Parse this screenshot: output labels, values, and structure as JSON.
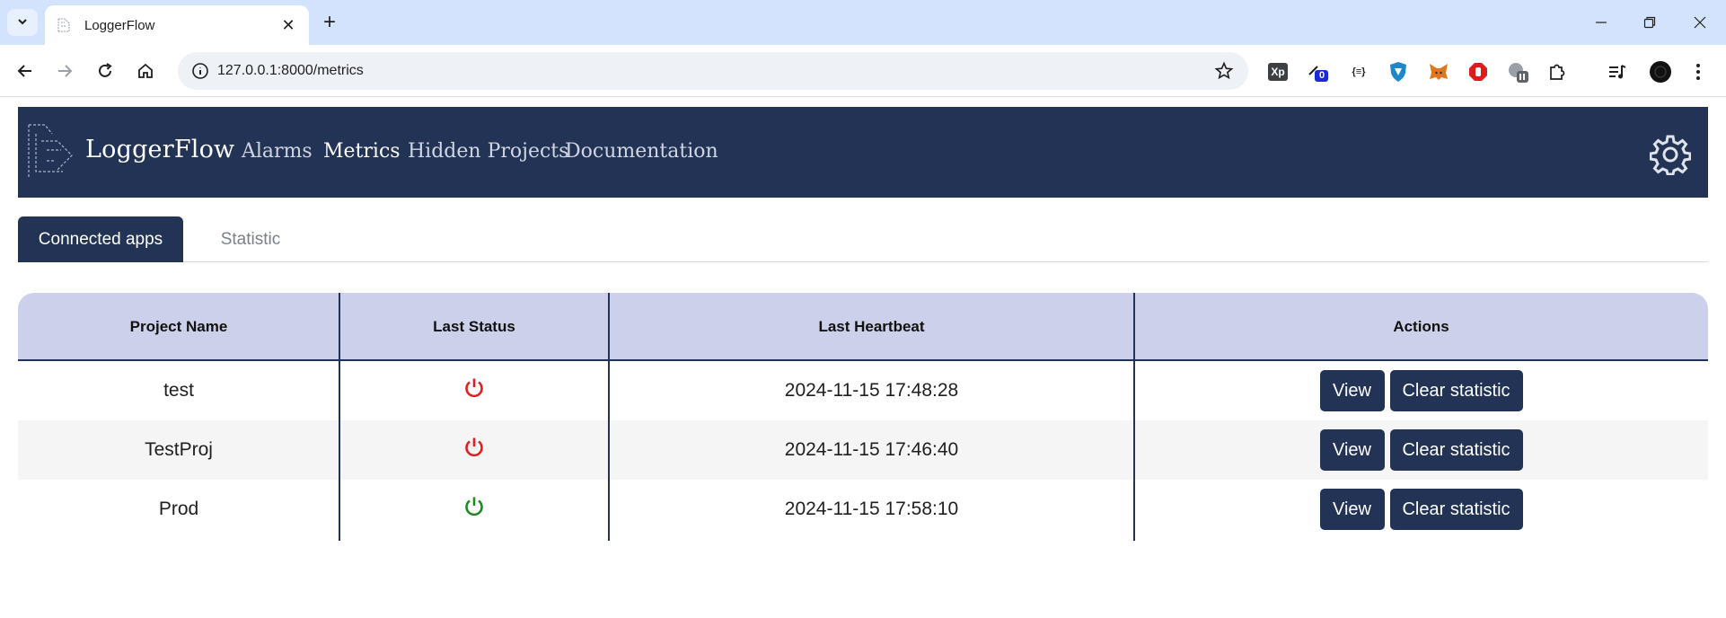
{
  "browser": {
    "tab_title": "LoggerFlow",
    "url": "127.0.0.1:8000/metrics",
    "extensions": {
      "xp_label": "Xp",
      "counter_badge": "0",
      "json_label": "{≡}"
    }
  },
  "app": {
    "brand": "LoggerFlow",
    "nav": [
      {
        "label": "Alarms",
        "active": false
      },
      {
        "label": "Metrics",
        "active": true
      },
      {
        "label": "Hidden Projects",
        "active": false
      },
      {
        "label": "Documentation",
        "active": false
      }
    ]
  },
  "page_tabs": [
    {
      "label": "Connected apps",
      "active": true
    },
    {
      "label": "Statistic",
      "active": false
    }
  ],
  "table": {
    "headers": [
      "Project Name",
      "Last Status",
      "Last Heartbeat",
      "Actions"
    ],
    "rows": [
      {
        "project": "test",
        "status": "offline",
        "heartbeat": "2024-11-15 17:48:28"
      },
      {
        "project": "TestProj",
        "status": "offline",
        "heartbeat": "2024-11-15 17:46:40"
      },
      {
        "project": "Prod",
        "status": "online",
        "heartbeat": "2024-11-15 17:58:10"
      }
    ],
    "actions": {
      "view_label": "View",
      "clear_label": "Clear statistic"
    }
  },
  "colors": {
    "navbar": "#223355",
    "header_bg": "#cdd0ea",
    "status_offline": "#e02020",
    "status_online": "#1f8a1f"
  }
}
